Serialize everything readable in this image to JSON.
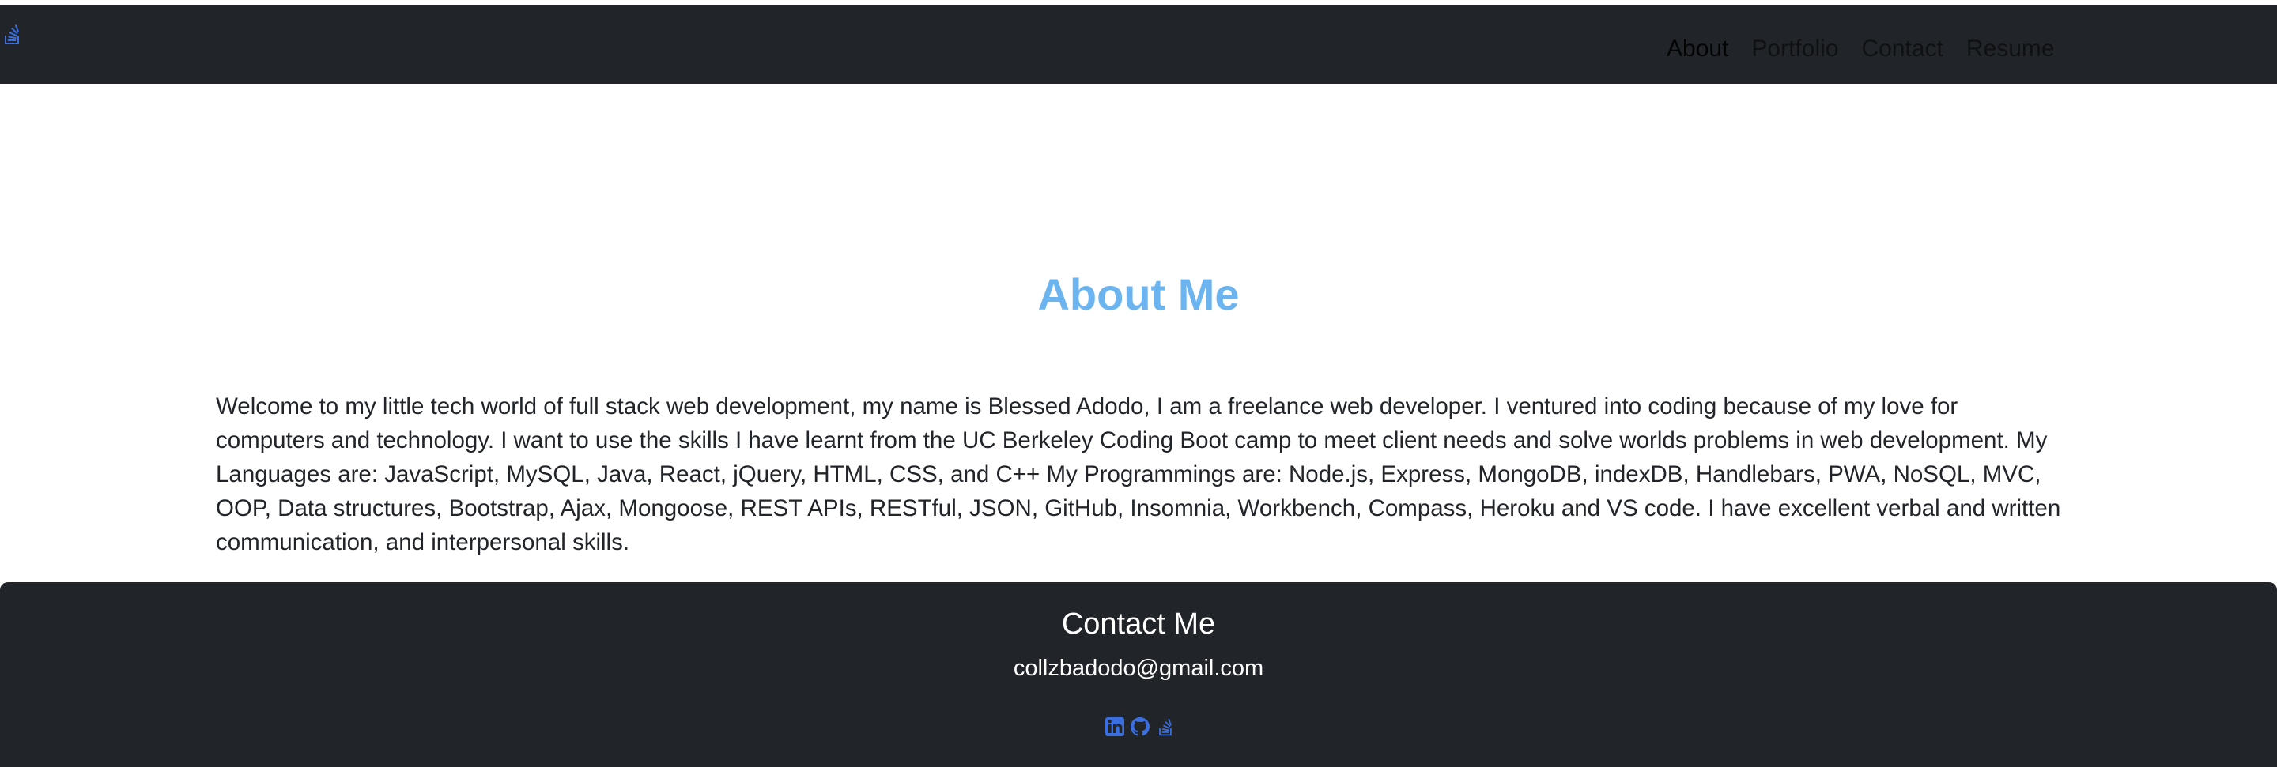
{
  "navbar": {
    "brand_icon": "stack-overflow-icon",
    "links": [
      {
        "label": "About",
        "active": true
      },
      {
        "label": "Portfolio",
        "active": false
      },
      {
        "label": "Contact",
        "active": false
      },
      {
        "label": "Resume",
        "active": false
      }
    ]
  },
  "about": {
    "title": "About Me",
    "text": "Welcome to my little tech world of full stack web development, my name is Blessed Adodo, I am a freelance web developer. I ventured into coding because of my love for computers and technology. I want to use the skills I have learnt from the UC Berkeley Coding Boot camp to meet client needs and solve worlds problems in web development. My Languages are: JavaScript, MySQL, Java, React, jQuery, HTML, CSS, and C++ My Programmings are: Node.js, Express, MongoDB, indexDB, Handlebars, PWA, NoSQL, MVC, OOP, Data structures, Bootstrap, Ajax, Mongoose, REST APIs, RESTful, JSON, GitHub, Insomnia, Workbench, Compass, Heroku and VS code. I have excellent verbal and written communication, and interpersonal skills."
  },
  "footer": {
    "title": "Contact Me",
    "email": "collzbadodo@gmail.com",
    "social_icons": [
      "linkedin-icon",
      "github-icon",
      "stack-overflow-icon"
    ]
  },
  "colors": {
    "navbar_bg": "#212529",
    "title_accent": "#6cb4f0",
    "icon_blue": "#3b6fe0",
    "footer_bg": "#212529"
  }
}
